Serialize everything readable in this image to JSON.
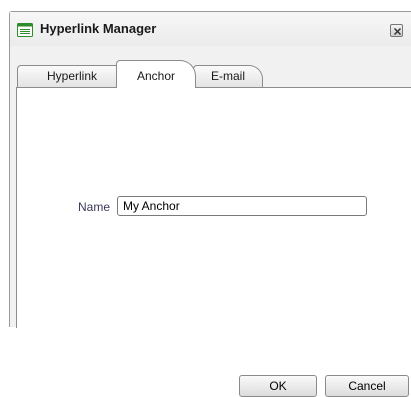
{
  "dialog": {
    "title": "Hyperlink Manager",
    "title_icon": "document-list-icon",
    "close_icon": "close-icon"
  },
  "tabs": [
    {
      "label": "Hyperlink",
      "active": false
    },
    {
      "label": "Anchor",
      "active": true
    },
    {
      "label": "E-mail",
      "active": false
    }
  ],
  "anchor_form": {
    "name_label": "Name",
    "name_value": "My Anchor"
  },
  "buttons": {
    "ok_label": "OK",
    "cancel_label": "Cancel"
  },
  "colors": {
    "icon_green": "#2e8b2e",
    "label_color": "#3a3a5a"
  }
}
